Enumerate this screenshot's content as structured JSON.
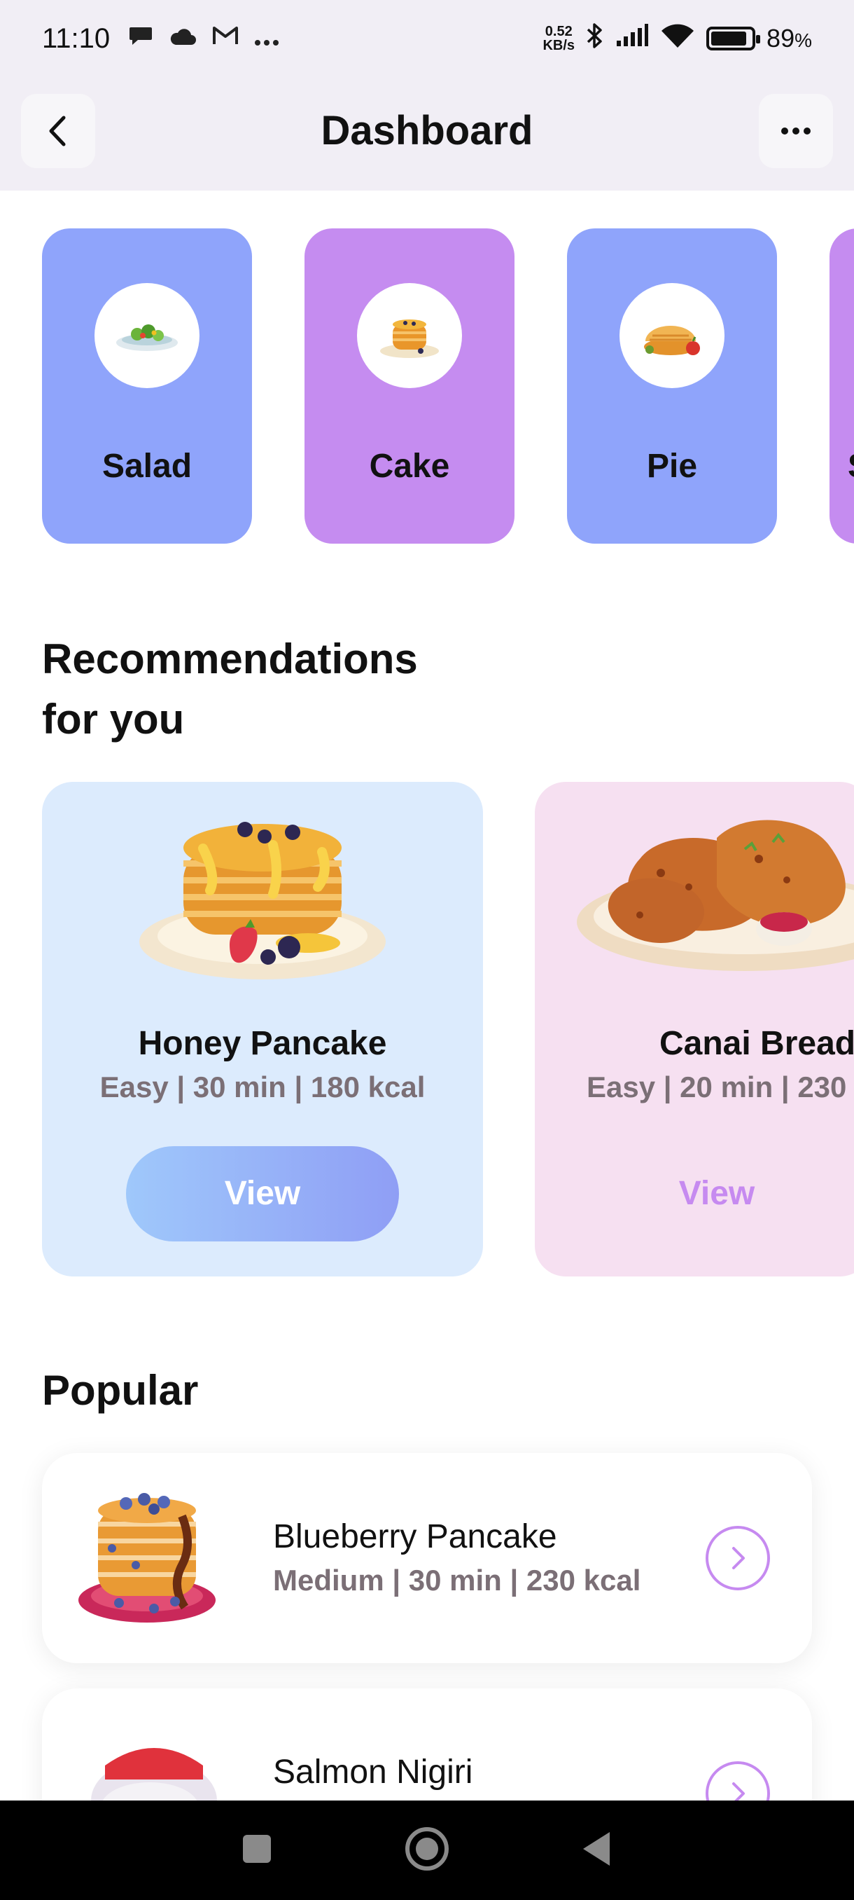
{
  "status_bar": {
    "time": "11:10",
    "net_speed_value": "0.52",
    "net_speed_unit": "KB/s",
    "battery": "89",
    "battery_unit": "%",
    "battery_level": 0.89,
    "icons": [
      "chat-icon",
      "cloud-icon",
      "mail-icon",
      "more-dots-icon",
      "bluetooth-icon",
      "signal-icon",
      "wifi-icon",
      "battery-icon"
    ]
  },
  "header": {
    "title": "Dashboard",
    "back_icon": "chevron-left-icon",
    "more_icon": "more-horizontal-icon"
  },
  "categories": [
    {
      "label": "Salad",
      "color": "#8fa4fb"
    },
    {
      "label": "Cake",
      "color": "#c58cf0"
    },
    {
      "label": "Pie",
      "color": "#8fa4fb"
    },
    {
      "label": "S",
      "color": "#c58cf0"
    }
  ],
  "recommendations": {
    "title_line1": "Recommendations",
    "title_line2": "for you",
    "items": [
      {
        "name": "Honey Pancake",
        "meta": "Easy | 30 min | 180 kcal",
        "button": "View",
        "bg": "#dcebfd"
      },
      {
        "name": "Canai Bread",
        "meta": "Easy | 20 min | 230",
        "button": "View",
        "bg": "#f6e0f1"
      }
    ]
  },
  "popular": {
    "title": "Popular",
    "items": [
      {
        "name": "Blueberry Pancake",
        "meta": "Medium | 30 min | 230 kcal"
      },
      {
        "name": "Salmon Nigiri",
        "meta": ""
      }
    ]
  },
  "colors": {
    "accent_purple": "#c68af0",
    "accent_blue": "#8fa4fb",
    "meta_text": "#7b6f76"
  }
}
